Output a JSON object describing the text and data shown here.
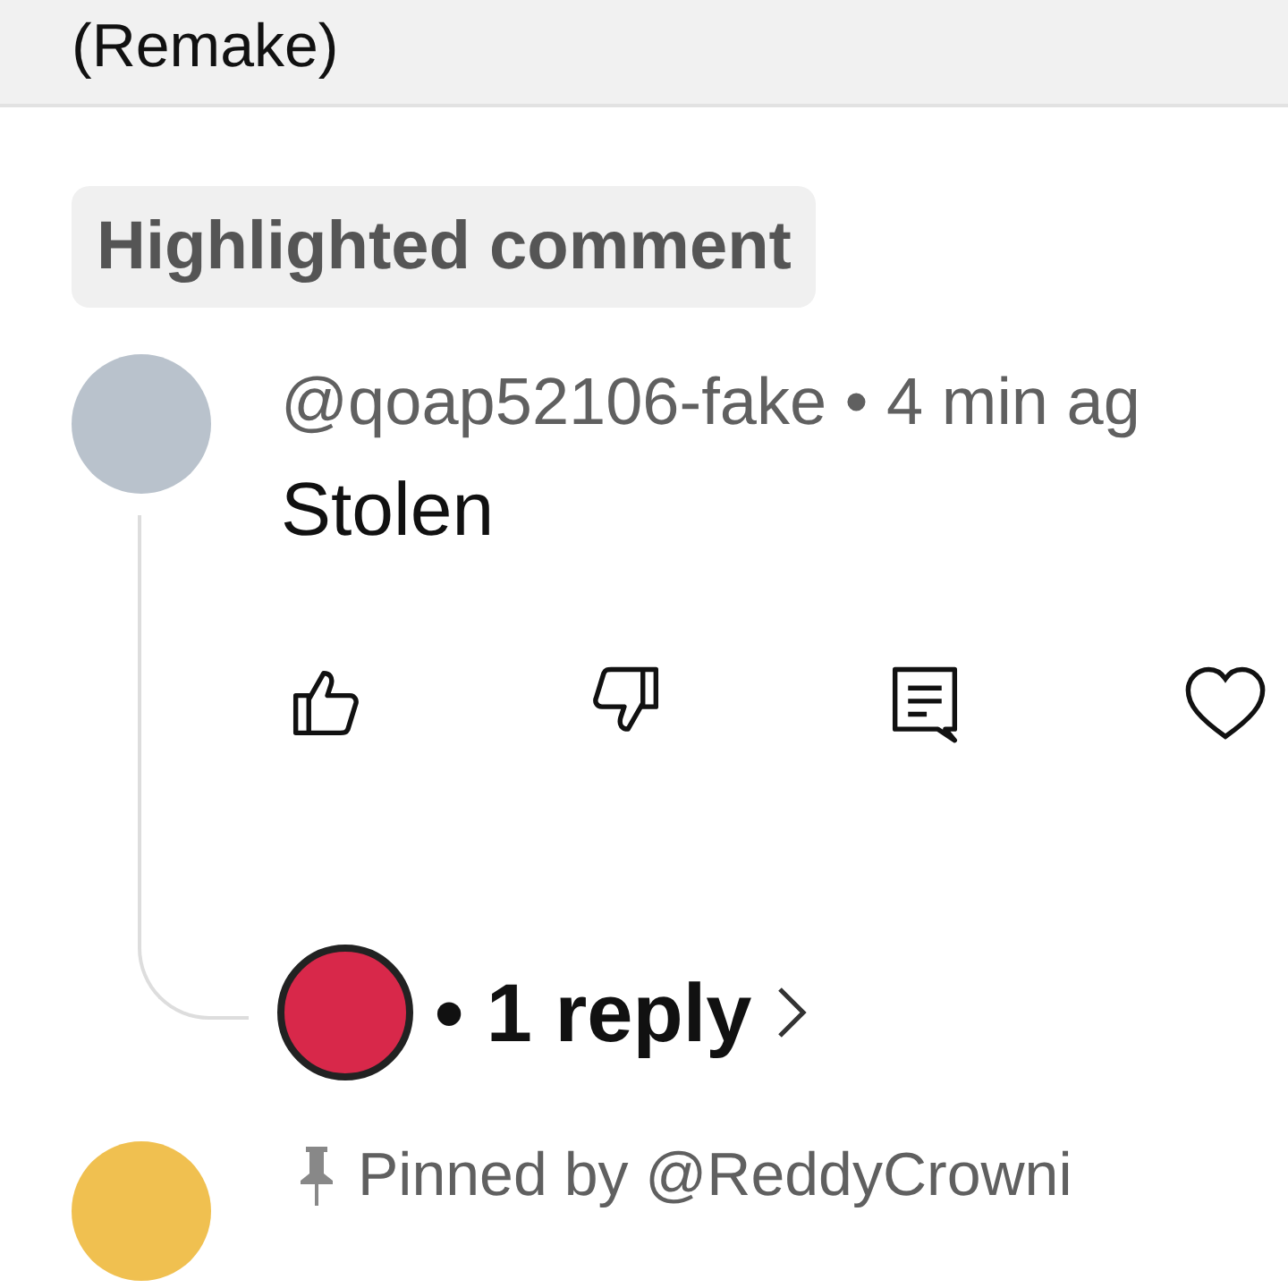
{
  "video_title": {
    "text": "(Remake)"
  },
  "highlight_label": "Highlighted comment",
  "comment": {
    "author": "@qoap52106-fake",
    "separator": "•",
    "time": "4 min ag",
    "text": "Stolen",
    "actions": [
      {
        "kind": "like"
      },
      {
        "kind": "dislike"
      },
      {
        "kind": "reply"
      },
      {
        "kind": "heart"
      }
    ],
    "replies": {
      "separator": "•",
      "label": "1 reply"
    }
  },
  "next_comment": {
    "pinned_label": "Pinned by @ReddyCrowni"
  }
}
